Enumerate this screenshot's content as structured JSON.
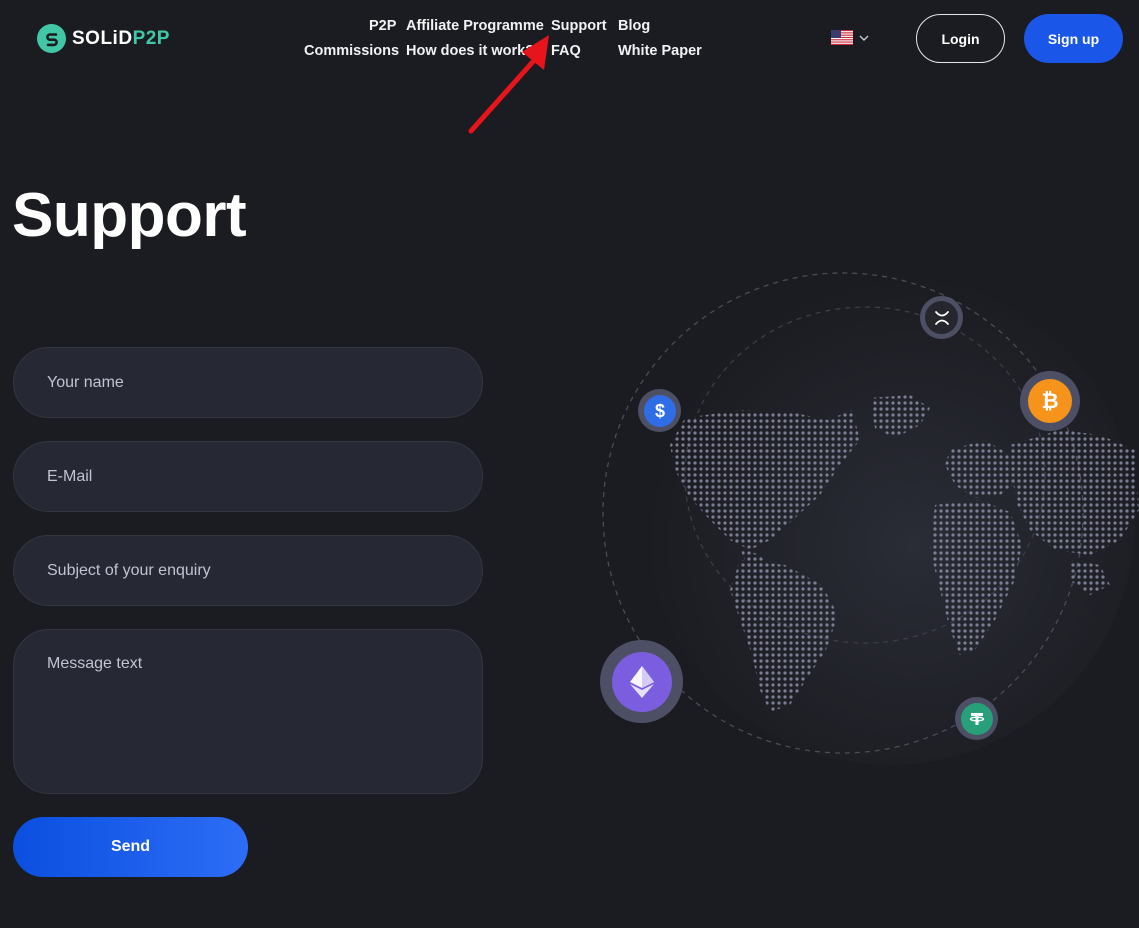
{
  "header": {
    "logo": {
      "text_white": "SOLiD",
      "text_green": "P2P"
    },
    "nav": [
      {
        "label": "P2P"
      },
      {
        "label": "Affiliate Programme"
      },
      {
        "label": "Support"
      },
      {
        "label": "Blog"
      },
      {
        "label": "Commissions"
      },
      {
        "label": "How does it work?"
      },
      {
        "label": "FAQ"
      },
      {
        "label": "White Paper"
      }
    ],
    "language_icon": "us-flag-icon",
    "login_label": "Login",
    "signup_label": "Sign up"
  },
  "main": {
    "title": "Support",
    "form": {
      "name_placeholder": "Your name",
      "email_placeholder": "E-Mail",
      "subject_placeholder": "Subject of your enquiry",
      "message_placeholder": "Message text",
      "send_label": "Send"
    }
  },
  "illustration": {
    "coins": [
      "ripple-icon",
      "bitcoin-icon",
      "usd-coin-icon",
      "ethereum-icon",
      "tether-icon"
    ]
  },
  "colors": {
    "background": "#1b1c21",
    "accent_blue": "#1a56e8",
    "brand_green": "#41c7a6",
    "field_bg": "#262833",
    "annotation_red": "#e8141b"
  }
}
